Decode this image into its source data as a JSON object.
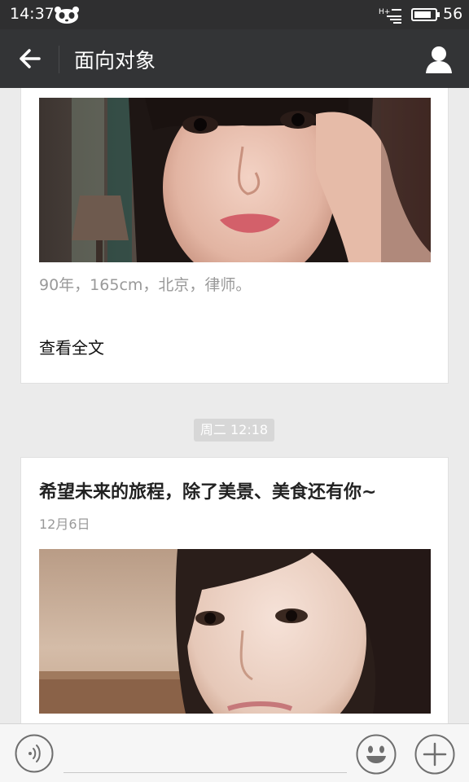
{
  "status_bar": {
    "time": "14:37",
    "battery_level": "56",
    "network_label": "H+"
  },
  "header": {
    "title": "面向对象"
  },
  "feed": {
    "post_top": {
      "description": "90年，165cm，北京，律师。",
      "read_full_label": "查看全文"
    },
    "timestamp_badge": "周二 12:18",
    "post_bottom": {
      "title": "希望未来的旅程，除了美景、美食还有你~",
      "date": "12月6日"
    }
  },
  "input_bar": {
    "message_placeholder": ""
  },
  "icons": {
    "back": "arrow-left-icon",
    "profile": "person-icon",
    "voice": "voice-icon",
    "emoji": "smiley-icon",
    "add": "plus-icon"
  },
  "colors": {
    "header_bg": "#333436",
    "status_bg": "#2f2f30",
    "feed_bg": "#ebebeb",
    "card_bg": "#ffffff",
    "badge_bg": "#d7d7d7"
  }
}
